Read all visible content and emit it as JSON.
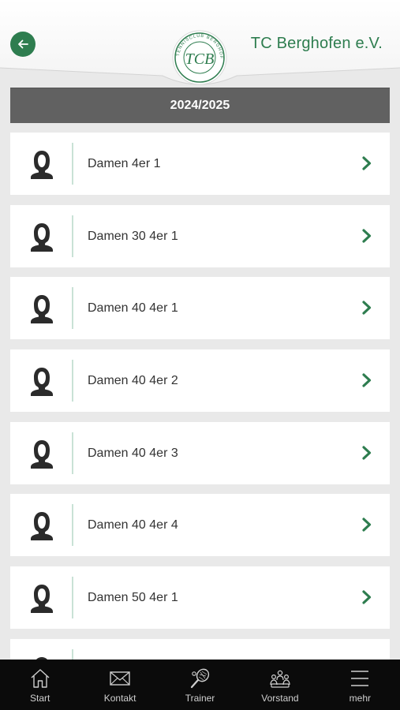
{
  "header": {
    "club_name": "TC Berghofen e.V.",
    "logo_text": "TENNISCLUB BERGHOFEN E.V.",
    "logo_letters": "TCB"
  },
  "season": "2024/2025",
  "teams": [
    {
      "label": "Damen 4er 1"
    },
    {
      "label": "Damen 30 4er 1"
    },
    {
      "label": "Damen 40 4er 1"
    },
    {
      "label": "Damen 40 4er 2"
    },
    {
      "label": "Damen 40 4er 3"
    },
    {
      "label": "Damen 40 4er 4"
    },
    {
      "label": "Damen 50 4er 1"
    },
    {
      "label": ""
    }
  ],
  "tabs": [
    {
      "label": "Start",
      "icon": "home-icon"
    },
    {
      "label": "Kontakt",
      "icon": "mail-icon"
    },
    {
      "label": "Trainer",
      "icon": "tennis-racket-icon"
    },
    {
      "label": "Vorstand",
      "icon": "board-icon"
    },
    {
      "label": "mehr",
      "icon": "menu-icon"
    }
  ],
  "colors": {
    "accent": "#2e7d4f",
    "season_bar": "#616161",
    "tabbar": "#0b0b0b",
    "background": "#e9e9e9"
  }
}
